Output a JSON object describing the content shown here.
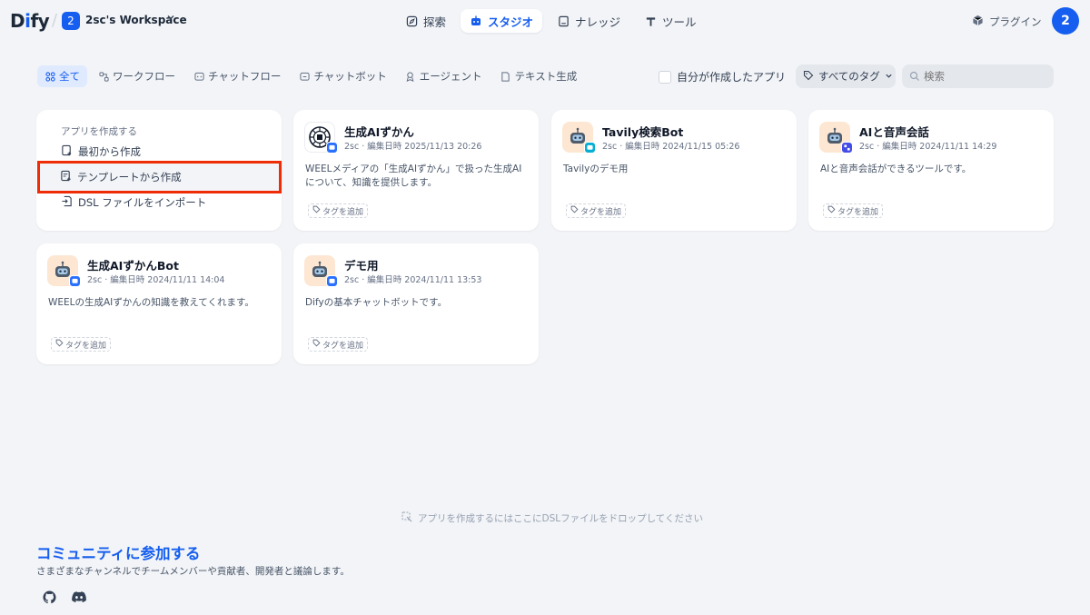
{
  "header": {
    "logo_pre": "D",
    "logo_i": "i",
    "logo_post": "fy",
    "workspace_badge": "2",
    "workspace_name": "2sc's Workspace",
    "nav": [
      {
        "label": "探索",
        "icon": "compass-icon"
      },
      {
        "label": "スタジオ",
        "icon": "robot-icon",
        "active": true
      },
      {
        "label": "ナレッジ",
        "icon": "book-icon"
      },
      {
        "label": "ツール",
        "icon": "hammer-icon"
      }
    ],
    "plugin_label": "プラグイン",
    "avatar": "2"
  },
  "filters": [
    {
      "label": "全て",
      "active": true
    },
    {
      "label": "ワークフロー"
    },
    {
      "label": "チャットフロー"
    },
    {
      "label": "チャットボット"
    },
    {
      "label": "エージェント"
    },
    {
      "label": "テキスト生成"
    }
  ],
  "mine_label": "自分が作成したアプリ",
  "tag_filter_label": "すべてのタグ",
  "search_placeholder": "検索",
  "create": {
    "title": "アプリを作成する",
    "blank": "最初から作成",
    "template": "テンプレートから作成",
    "import": "DSL ファイルをインポート"
  },
  "apps": [
    {
      "title": "生成AIずかん",
      "meta": "2sc · 編集日時 2025/11/13 20:26",
      "desc": "WEELメディアの「生成AIずかん」で扱った生成AIについて、知識を提供します。",
      "tag": "タグを追加"
    },
    {
      "title": "Tavily検索Bot",
      "meta": "2sc · 編集日時 2024/11/15 05:26",
      "desc": "Tavilyのデモ用",
      "tag": "タグを追加"
    },
    {
      "title": "AIと音声会話",
      "meta": "2sc · 編集日時 2024/11/11 14:29",
      "desc": "AIと音声会話ができるツールです。",
      "tag": "タグを追加"
    },
    {
      "title": "生成AIずかんBot",
      "meta": "2sc · 編集日時 2024/11/11 14:04",
      "desc": "WEELの生成AIずかんの知識を教えてくれます。",
      "tag": "タグを追加"
    },
    {
      "title": "デモ用",
      "meta": "2sc · 編集日時 2024/11/11 13:53",
      "desc": "Difyの基本チャットボットです。",
      "tag": "タグを追加"
    }
  ],
  "dropzone": "アプリを作成するにはここにDSLファイルをドロップしてください",
  "community": {
    "title": "コミュニティに参加する",
    "desc": "さまざまなチャンネルでチームメンバーや貢献者、開発者と議論します。"
  },
  "colors": {
    "accent": "#155eef",
    "highlight": "#ee2c06",
    "background": "#f2f4f7"
  }
}
